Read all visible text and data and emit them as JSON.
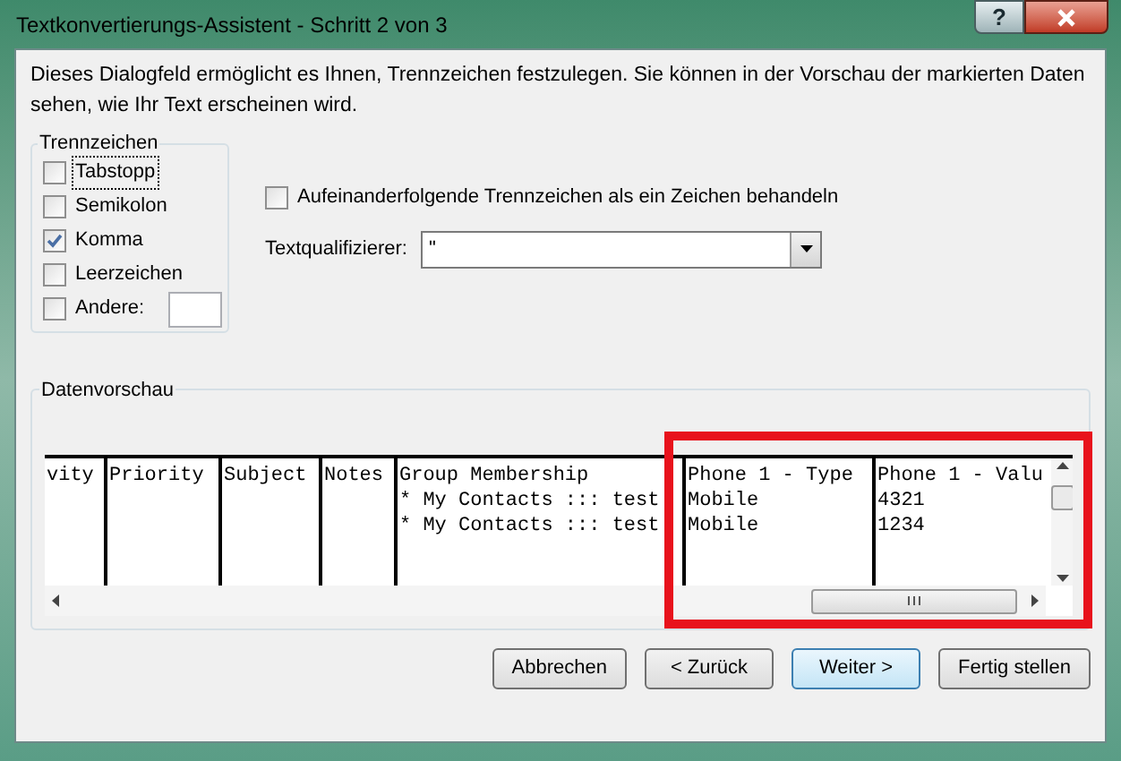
{
  "window": {
    "title": "Textkonvertierungs-Assistent - Schritt 2 von 3",
    "help_button": "?"
  },
  "description": "Dieses Dialogfeld ermöglicht es Ihnen, Trennzeichen festzulegen. Sie können in der Vorschau der markierten Daten sehen, wie Ihr Text erscheinen wird.",
  "delimiters": {
    "title": "Trennzeichen",
    "items": [
      {
        "label": "Tabstopp",
        "checked": false,
        "focused": true
      },
      {
        "label": "Semikolon",
        "checked": false,
        "focused": false
      },
      {
        "label": "Komma",
        "checked": true,
        "focused": false
      },
      {
        "label": "Leerzeichen",
        "checked": false,
        "focused": false
      },
      {
        "label": "Andere:",
        "checked": false,
        "focused": false,
        "has_field": true
      }
    ]
  },
  "consecutive": {
    "label": "Aufeinanderfolgende Trennzeichen als ein Zeichen behandeln",
    "checked": false
  },
  "text_qualifier": {
    "label": "Textqualifizierer:",
    "value": "\""
  },
  "preview": {
    "title": "Datenvorschau",
    "columns": [
      {
        "header": "vity"
      },
      {
        "header": "Priority"
      },
      {
        "header": "Subject"
      },
      {
        "header": "Notes"
      },
      {
        "header": "Group Membership",
        "cells": [
          "* My Contacts ::: test",
          "* My Contacts ::: test"
        ]
      },
      {
        "header": "Phone 1 - Type",
        "cells": [
          "Mobile",
          "Mobile"
        ]
      },
      {
        "header": "Phone 1 - Valu",
        "cells": [
          "4321",
          "1234"
        ]
      }
    ]
  },
  "buttons": [
    {
      "label": "Abbrechen",
      "default": false
    },
    {
      "label": "< Zurück",
      "default": false
    },
    {
      "label": "Weiter >",
      "default": true
    },
    {
      "label": "Fertig stellen",
      "default": false
    }
  ]
}
